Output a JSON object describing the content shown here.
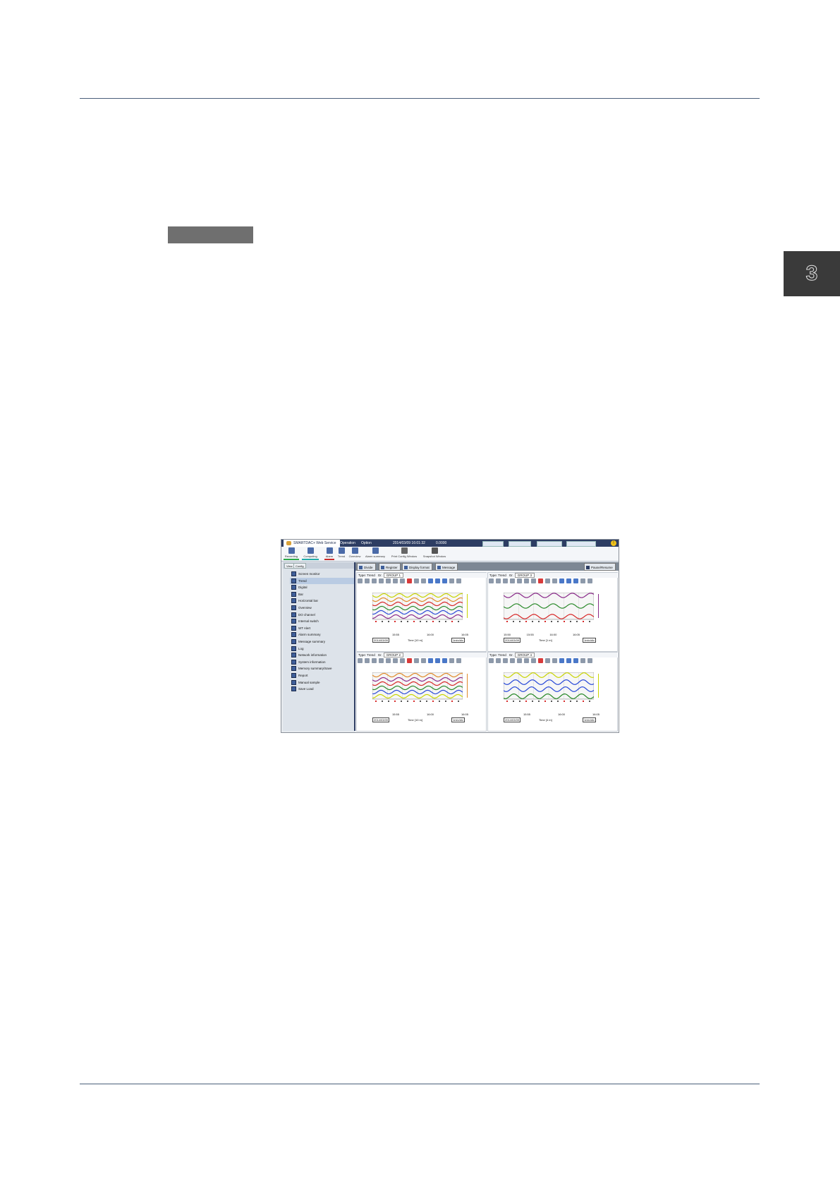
{
  "page": {
    "chapter_number": "3"
  },
  "app": {
    "title": "SMARTDAC+ Web Service",
    "menu": [
      "Operation",
      "Option"
    ],
    "datetime": "2014/03/09 16:01:32",
    "status": "0.0000"
  },
  "toolbar": {
    "items": [
      "Recording",
      "Computing",
      "Alarm",
      "Trend",
      "Overview",
      "Alarm summary",
      "Print Config Window",
      "Snapshot Window"
    ]
  },
  "sidebar": {
    "tabs": [
      "View",
      "Config"
    ],
    "items": [
      "Screen monitor",
      "Trend",
      "Digital",
      "Bar",
      "Horizontal bar",
      "Overview",
      "DO channel",
      "Internal switch",
      "WT Alert",
      "Alarm summary",
      "Message summary",
      "Log",
      "Network information",
      "System information",
      "Memory summary/Save",
      "Report",
      "Manual sample",
      "Save Load"
    ],
    "selected": "Trend"
  },
  "content_tabs": [
    "Divide",
    "Register",
    "Display format",
    "Message"
  ],
  "pause_button": "Pause/Resume",
  "panels": [
    {
      "type_label": "Type: Trend",
      "group_label": "Gr.",
      "group": "GROUP 1",
      "times": [
        "15:55",
        "16:00",
        "16:05"
      ],
      "time_label": "Time [10 m]",
      "date": "2014/03/09",
      "span": "1min/div"
    },
    {
      "type_label": "Type: Trend",
      "group_label": "Gr.",
      "group": "GROUP 3",
      "times": [
        "15:50",
        "15:55",
        "16:00",
        "16:05"
      ],
      "time_label": "Time [1 m]",
      "date": "2014/03/09",
      "span": "1min/div"
    },
    {
      "type_label": "Type: Trend",
      "group_label": "Gr.",
      "group": "GROUP 2",
      "times": [
        "15:55",
        "16:00",
        "16:05"
      ],
      "time_label": "Time [10 m]",
      "date": "2014/03/09",
      "span": "1min/div"
    },
    {
      "type_label": "Type: Trend",
      "group_label": "Gr.",
      "group": "GROUP 4",
      "times": [
        "15:55",
        "16:00",
        "16:05"
      ],
      "time_label": "Time [4 m]",
      "date": "2014/03/09",
      "span": "1min/div"
    }
  ],
  "colors": {
    "titlebar": "#2d3d63",
    "wave_colors": [
      "#c8d400",
      "#e08a2a",
      "#d82a2a",
      "#2a8a2a",
      "#2a4ad8",
      "#8a2a8a"
    ]
  }
}
